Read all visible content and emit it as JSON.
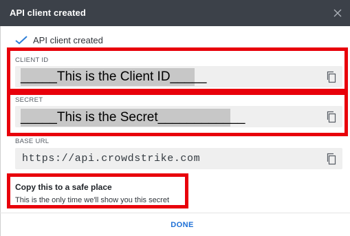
{
  "dialog": {
    "title": "API client created",
    "close_icon": "close-icon"
  },
  "success": {
    "icon": "check-icon",
    "message": "API client created"
  },
  "client_id": {
    "label": "CLIENT ID",
    "redacted_text": "_____This is the Client ID_____",
    "copy_icon": "copy-icon"
  },
  "secret": {
    "label": "SECRET",
    "redacted_text": "_____This is the Secret____________",
    "copy_icon": "copy-icon"
  },
  "base_url": {
    "label": "BASE URL",
    "value": "https://api.crowdstrike.com",
    "copy_icon": "copy-icon"
  },
  "notice": {
    "title": "Copy this to a safe place",
    "text": "This is the only time we'll show you this secret"
  },
  "footer": {
    "done_label": "DONE"
  },
  "colors": {
    "header_bg": "#3c4149",
    "accent_blue": "#1d6fd6",
    "check_blue": "#2f7fd8",
    "highlight_red": "#e8000b",
    "field_bg": "#efefef",
    "redaction_bg": "#c7c7c7"
  }
}
